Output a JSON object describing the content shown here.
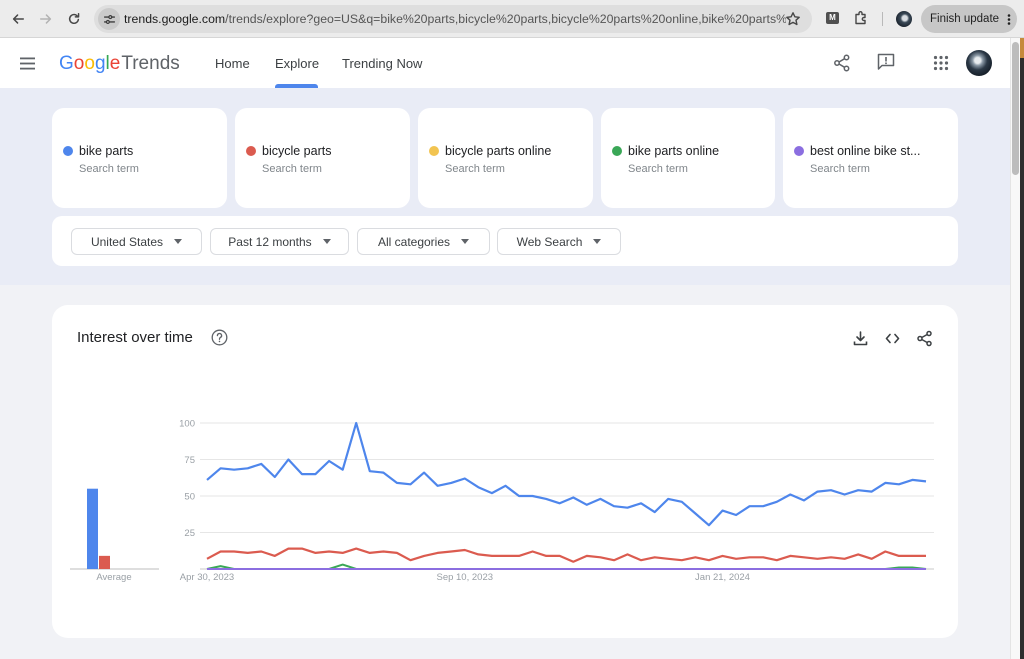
{
  "browser": {
    "url_host": "trends.google.com",
    "url_path": "/trends/explore?geo=US&q=bike%20parts,bicycle%20parts,bicycle%20parts%20online,bike%20parts%2...",
    "extension_badge": "M",
    "finish_update_label": "Finish update"
  },
  "header": {
    "logo_letters": [
      "G",
      "o",
      "o",
      "g",
      "l",
      "e"
    ],
    "logo_product": "Trends",
    "tabs": [
      {
        "label": "Home",
        "active": false
      },
      {
        "label": "Explore",
        "active": true
      },
      {
        "label": "Trending Now",
        "active": false
      }
    ]
  },
  "search_terms": [
    {
      "label": "bike parts",
      "sublabel": "Search term",
      "color": "#4e86ec"
    },
    {
      "label": "bicycle parts",
      "sublabel": "Search term",
      "color": "#db5b4f"
    },
    {
      "label": "bicycle parts online",
      "sublabel": "Search term",
      "color": "#f2c451"
    },
    {
      "label": "bike parts online",
      "sublabel": "Search term",
      "color": "#3aa757"
    },
    {
      "label": "best online bike st...",
      "sublabel": "Search term",
      "color": "#8b6ee0"
    }
  ],
  "filters": [
    {
      "label": "United States"
    },
    {
      "label": "Past 12 months"
    },
    {
      "label": "All categories"
    },
    {
      "label": "Web Search"
    }
  ],
  "interest_card": {
    "title": "Interest over time"
  },
  "chart_data": {
    "type": "line",
    "title": "Interest over time",
    "xlabel": "",
    "ylabel": "",
    "ylim": [
      0,
      100
    ],
    "yticks": [
      25,
      50,
      75,
      100
    ],
    "grid": true,
    "legend": "none",
    "xticks": [
      {
        "index": 0,
        "label": "Apr 30, 2023"
      },
      {
        "index": 19,
        "label": "Sep 10, 2023"
      },
      {
        "index": 38,
        "label": "Jan 21, 2024"
      }
    ],
    "series": [
      {
        "name": "bike parts",
        "color": "#4e86ec",
        "values": [
          61,
          69,
          68,
          69,
          72,
          63,
          75,
          65,
          65,
          74,
          68,
          100,
          67,
          66,
          59,
          58,
          66,
          57,
          59,
          62,
          56,
          52,
          57,
          50,
          50,
          48,
          45,
          49,
          44,
          48,
          43,
          42,
          45,
          39,
          48,
          46,
          38,
          30,
          40,
          37,
          43,
          43,
          46,
          51,
          47,
          53,
          54,
          51,
          54,
          53,
          59,
          58,
          61,
          60
        ]
      },
      {
        "name": "bicycle parts",
        "color": "#db5b4f",
        "values": [
          7,
          12,
          12,
          11,
          12,
          9,
          14,
          14,
          11,
          12,
          11,
          14,
          11,
          12,
          11,
          6,
          9,
          11,
          12,
          13,
          10,
          9,
          9,
          9,
          12,
          9,
          9,
          5,
          9,
          8,
          6,
          10,
          6,
          8,
          7,
          6,
          8,
          6,
          9,
          7,
          8,
          8,
          6,
          9,
          8,
          7,
          8,
          7,
          10,
          7,
          12,
          9,
          9,
          9
        ]
      },
      {
        "name": "bicycle parts online",
        "color": "#f2c451",
        "values": [
          0,
          0,
          0,
          0,
          0,
          0,
          0,
          0,
          0,
          0,
          0,
          0,
          0,
          0,
          0,
          0,
          0,
          0,
          0,
          0,
          0,
          0,
          0,
          0,
          0,
          0,
          0,
          0,
          0,
          0,
          0,
          0,
          0,
          0,
          0,
          0,
          0,
          0,
          0,
          0,
          0,
          0,
          0,
          0,
          0,
          0,
          0,
          0,
          0,
          0,
          0,
          0,
          0,
          0
        ]
      },
      {
        "name": "bike parts online",
        "color": "#3aa757",
        "values": [
          0,
          2,
          0,
          0,
          0,
          0,
          0,
          0,
          0,
          0,
          3,
          0,
          0,
          0,
          0,
          0,
          0,
          0,
          0,
          0,
          0,
          0,
          0,
          0,
          0,
          0,
          0,
          0,
          0,
          0,
          0,
          0,
          0,
          0,
          0,
          0,
          0,
          0,
          0,
          0,
          0,
          0,
          0,
          0,
          0,
          0,
          0,
          0,
          0,
          0,
          0,
          1,
          1,
          0
        ]
      },
      {
        "name": "best online bike st...",
        "color": "#8b6ee0",
        "values": [
          0,
          0,
          0,
          0,
          0,
          0,
          0,
          0,
          0,
          0,
          0,
          0,
          0,
          0,
          0,
          0,
          0,
          0,
          0,
          0,
          0,
          0,
          0,
          0,
          0,
          0,
          0,
          0,
          0,
          0,
          0,
          0,
          0,
          0,
          0,
          0,
          0,
          0,
          0,
          0,
          0,
          0,
          0,
          0,
          0,
          0,
          0,
          0,
          0,
          0,
          0,
          0,
          0,
          0
        ]
      }
    ],
    "averages": {
      "label": "Average",
      "values": [
        55,
        9,
        0,
        0,
        0
      ]
    }
  }
}
